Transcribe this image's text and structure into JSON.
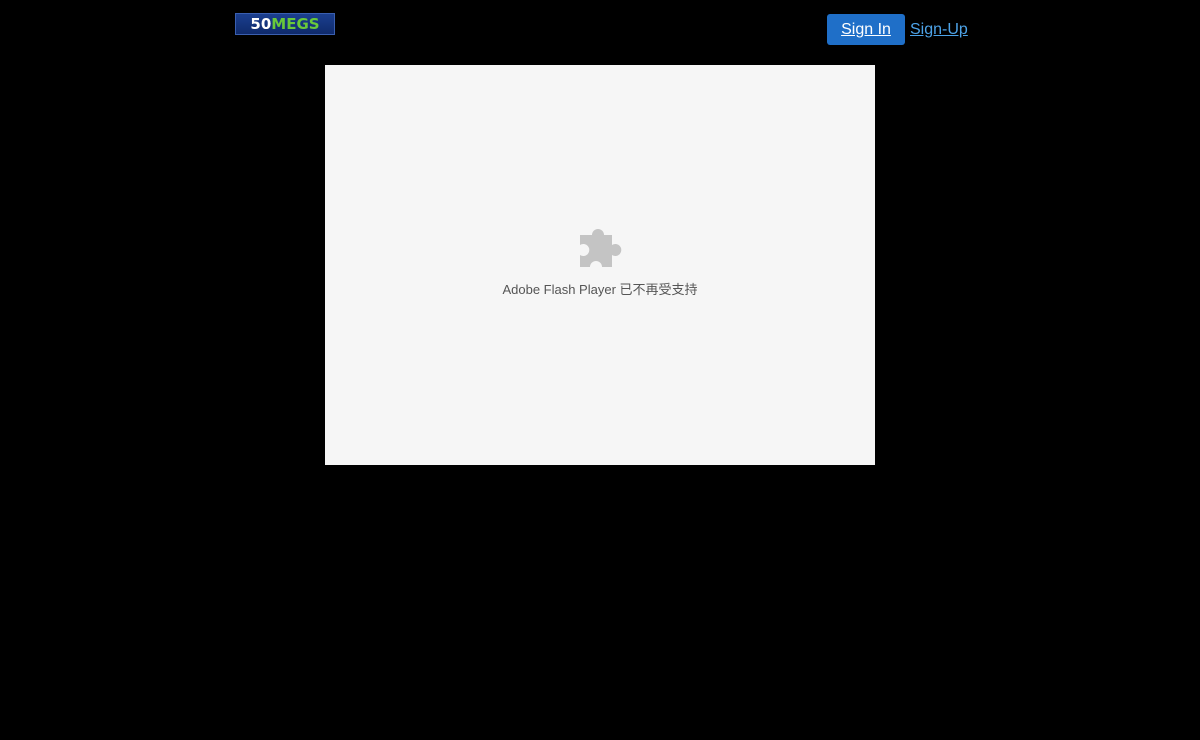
{
  "header": {
    "logo": {
      "number": "50",
      "word": "MEGS",
      "colors": {
        "background": "#12317a",
        "number": "#ffffff",
        "word": "#69c93a"
      }
    },
    "signin_label": "Sign In",
    "signup_label": "Sign-Up"
  },
  "plugin": {
    "icon": "puzzle-piece-icon",
    "message": "Adobe Flash Player 已不再受支持"
  },
  "colors": {
    "page_background": "#000000",
    "signin_button": "#1f6fc8",
    "signup_link": "#4da3e8",
    "plugin_background": "#f6f6f6",
    "icon": "#c4c4c4",
    "message_text": "#555555"
  }
}
